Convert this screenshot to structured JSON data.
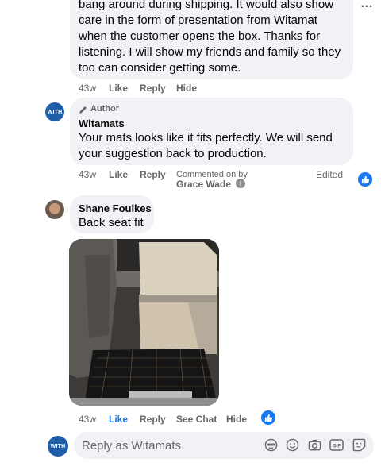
{
  "comments": [
    {
      "text": "bang around during shipping. It would also show care in the form of presentation from Witamat when the customer opens the box. Thanks for listening. I will show my friends and family so they too can consider getting some.",
      "actions": {
        "time": "43w",
        "like": "Like",
        "reply": "Reply",
        "hide": "Hide"
      }
    },
    {
      "badge": "Author",
      "name": "Witamats",
      "avatar_text": "WITH",
      "text": "Your mats looks like it fits perfectly. We will send your suggestion back to production.",
      "actions": {
        "time": "43w",
        "like": "Like",
        "reply": "Reply",
        "commented_on_by": "Commented on by",
        "commenter": "Grace Wade",
        "edited": "Edited"
      }
    },
    {
      "name": "Shane Foulkes",
      "text": "Back seat fit",
      "actions": {
        "time": "43w",
        "like": "Like",
        "reply": "Reply",
        "see_chat": "See Chat",
        "hide": "Hide"
      }
    }
  ],
  "composer": {
    "placeholder": "Reply as Witamats",
    "avatar_text": "WITH",
    "icons": [
      "avatar-sticker-icon",
      "emoji-icon",
      "camera-icon",
      "gif-icon",
      "sticker-icon"
    ]
  },
  "menu_glyph": "…",
  "colors": {
    "accent": "#1877f2",
    "bubble": "#f0f2f5",
    "muted": "#65676b"
  }
}
